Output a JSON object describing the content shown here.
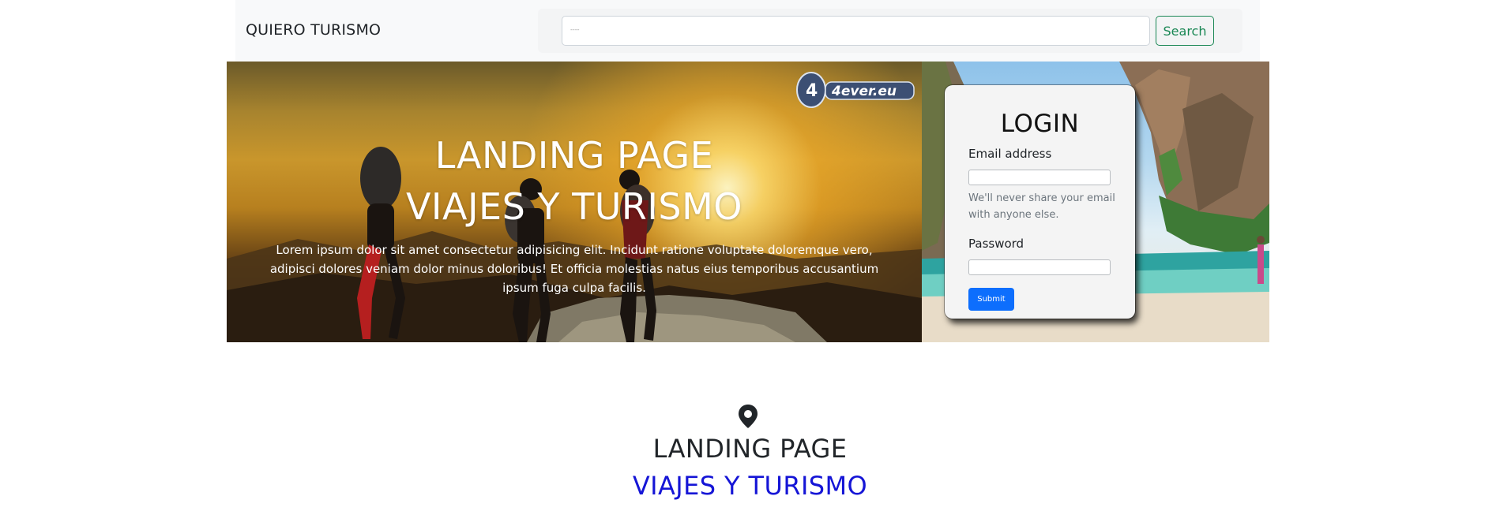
{
  "navbar": {
    "brand": "QUIERO TURISMO",
    "search_placeholder": "",
    "search_value": "----",
    "search_button": "Search"
  },
  "hero": {
    "title_line1": "LANDING PAGE",
    "title_line2": "VIAJES Y TURISMO",
    "text": "Lorem ipsum dolor sit amet consectetur adipisicing elit. Incidunt ratione voluptate doloremque vero, adipisci dolores veniam dolor minus doloribus! Et officia molestias natus eius temporibus accusantium ipsum fuga culpa facilis.",
    "watermark": "4ever.eu"
  },
  "login": {
    "title": "LOGIN",
    "email_label": "Email address",
    "email_value": "",
    "email_help": "We'll never share your email with anyone else.",
    "password_label": "Password",
    "password_value": "",
    "submit": "Submit"
  },
  "section": {
    "icon": "map-pin-icon",
    "title": "LANDING PAGE",
    "subtitle": "VIAJES Y TURISMO"
  },
  "colors": {
    "navbar_bg": "#f8f9fa",
    "search_btn": "#198754",
    "submit_btn": "#0d6efd",
    "subtitle": "#1515d6"
  }
}
